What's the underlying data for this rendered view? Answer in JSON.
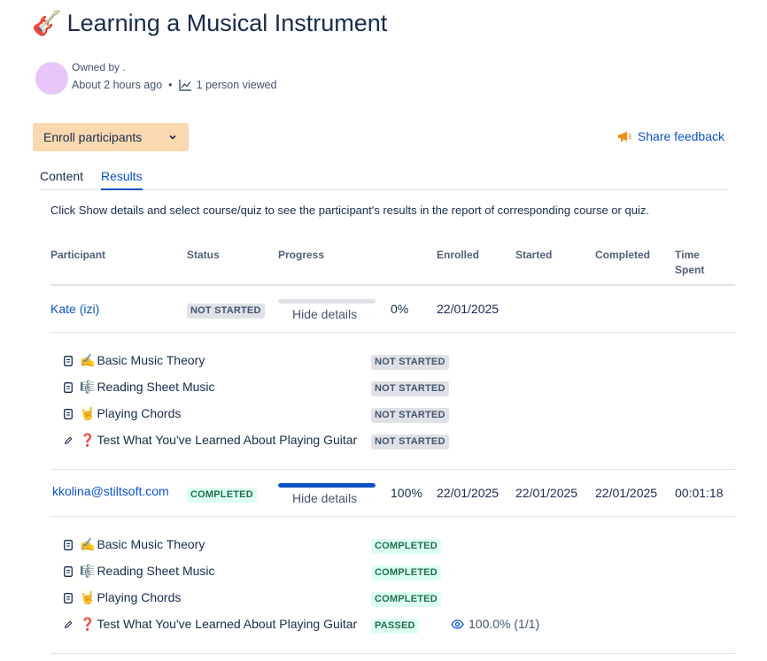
{
  "page": {
    "title_emoji": "🎸",
    "title": "Learning a Musical Instrument",
    "owned_by": "Owned by .",
    "time_ago": "About 2 hours ago",
    "dot": "•",
    "views": "1 person viewed"
  },
  "toolbar": {
    "enroll_label": "Enroll participants",
    "feedback_label": "Share feedback"
  },
  "tabs": [
    {
      "label": "Content",
      "active": false
    },
    {
      "label": "Results",
      "active": true
    }
  ],
  "hint": "Click Show details and select course/quiz to see the participant's results in the report of corresponding course or quiz.",
  "table": {
    "headers": {
      "participant": "Participant",
      "status": "Status",
      "progress": "Progress",
      "enrolled": "Enrolled",
      "started": "Started",
      "completed": "Completed",
      "time_spent_1": "Time",
      "time_spent_2": "Spent"
    },
    "rows": [
      {
        "participant": "Kate (izi)",
        "status": "NOT STARTED",
        "progress_fraction": 0,
        "progress_text": "0%",
        "toggle": "Hide details",
        "enrolled": "22/01/2025",
        "started": "",
        "completed": "",
        "time_spent": "",
        "items": [
          {
            "icon": "page-icon",
            "emoji": "✍️",
            "label": "Basic Music Theory",
            "status": "NOT STARTED"
          },
          {
            "icon": "page-icon",
            "emoji": "🎼",
            "label": "Reading Sheet Music",
            "status": "NOT STARTED"
          },
          {
            "icon": "page-icon",
            "emoji": "🤘",
            "label": "Playing Chords",
            "status": "NOT STARTED"
          },
          {
            "icon": "pencil-icon",
            "emoji": "❓",
            "label": "Test What You've Learned About Playing Guitar",
            "status": "NOT STARTED"
          }
        ]
      },
      {
        "participant": "kkolina@stiltsoft.com",
        "status": "COMPLETED",
        "progress_fraction": 1,
        "progress_text": "100%",
        "toggle": "Hide details",
        "enrolled": "22/01/2025",
        "started": "22/01/2025",
        "completed": "22/01/2025",
        "time_spent": "00:01:18",
        "items": [
          {
            "icon": "page-icon",
            "emoji": "✍️",
            "label": "Basic Music Theory",
            "status": "COMPLETED"
          },
          {
            "icon": "page-icon",
            "emoji": "🎼",
            "label": "Reading Sheet Music",
            "status": "COMPLETED"
          },
          {
            "icon": "page-icon",
            "emoji": "🤘",
            "label": "Playing Chords",
            "status": "COMPLETED"
          },
          {
            "icon": "pencil-icon",
            "emoji": "❓",
            "label": "Test What You've Learned About Playing Guitar",
            "status": "PASSED",
            "score": "100.0% (1/1)"
          }
        ]
      }
    ]
  },
  "colors": {
    "link": "#0c52c7",
    "enroll_bg": "#fad9b0",
    "avatar": "#e8c6f9",
    "lozenge_grey": "#dfe1e6",
    "lozenge_green": "#dcfff1"
  }
}
